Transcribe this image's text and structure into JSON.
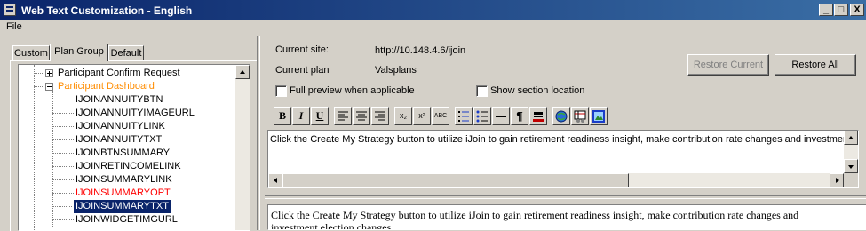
{
  "window": {
    "title": "Web Text Customization - English",
    "controls": {
      "minimize": "_",
      "maximize": "□",
      "close": "X"
    }
  },
  "menu": {
    "items": [
      {
        "label": "File"
      }
    ]
  },
  "tabs": [
    {
      "label": "Custom",
      "active": false
    },
    {
      "label": "Plan Group",
      "active": true
    },
    {
      "label": "Default",
      "active": false
    }
  ],
  "tree": {
    "nodes": [
      {
        "label": "Participant Confirm Request",
        "level": 0,
        "expander": "+",
        "color": "#000000",
        "selected": false
      },
      {
        "label": "Participant Dashboard",
        "level": 0,
        "expander": "-",
        "color": "#ff8c00",
        "selected": false
      },
      {
        "label": "IJOINANNUITYBTN",
        "level": 1,
        "color": "#000000",
        "selected": false
      },
      {
        "label": "IJOINANNUITYIMAGEURL",
        "level": 1,
        "color": "#000000",
        "selected": false
      },
      {
        "label": "IJOINANNUITYLINK",
        "level": 1,
        "color": "#000000",
        "selected": false
      },
      {
        "label": "IJOINANNUITYTXT",
        "level": 1,
        "color": "#000000",
        "selected": false
      },
      {
        "label": "IJOINBTNSUMMARY",
        "level": 1,
        "color": "#000000",
        "selected": false
      },
      {
        "label": "IJOINRETINCOMELINK",
        "level": 1,
        "color": "#000000",
        "selected": false
      },
      {
        "label": "IJOINSUMMARYLINK",
        "level": 1,
        "color": "#000000",
        "selected": false
      },
      {
        "label": "IJOINSUMMARYOPT",
        "level": 1,
        "color": "#ff0000",
        "selected": false
      },
      {
        "label": "IJOINSUMMARYTXT",
        "level": 1,
        "color": "#ffffff",
        "selected": true
      },
      {
        "label": "IJOINWIDGETIMGURL",
        "level": 1,
        "color": "#000000",
        "selected": false
      }
    ]
  },
  "info": {
    "site_label": "Current site:",
    "site_value": "http://10.148.4.6/ijoin",
    "plan_label": "Current plan",
    "plan_value": "Valsplans"
  },
  "buttons": {
    "restore_current": "Restore Current",
    "restore_all": "Restore All"
  },
  "options": {
    "full_preview": {
      "label": "Full preview when applicable",
      "checked": false
    },
    "show_section": {
      "label": "Show section location",
      "checked": false
    }
  },
  "toolbar": {
    "bold": "B",
    "italic": "I",
    "underline": "U",
    "subscript": "x₂",
    "superscript": "x²",
    "strikethrough": "ABC",
    "paragraph": "¶"
  },
  "editor": {
    "text": "Click the Create My Strategy button to utilize iJoin to gain retirement readiness insight, make contribution rate changes and investment election changes."
  },
  "preview": {
    "text": "Click the Create My Strategy button to utilize iJoin to gain retirement readiness insight, make contribution rate changes and investment election changes."
  },
  "colors": {
    "selection": "#0a246a",
    "expanded_parent": "#ff8c00",
    "modified_item": "#ff0000"
  }
}
